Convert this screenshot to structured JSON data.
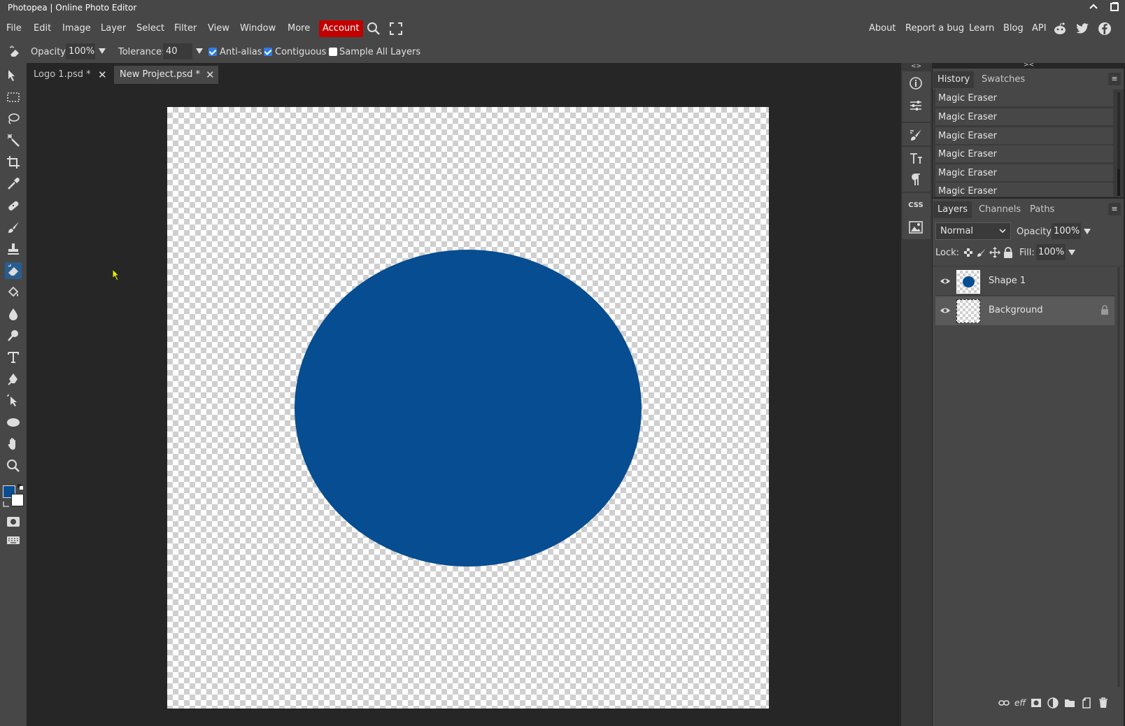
{
  "window": {
    "title": "Photopea | Online Photo Editor"
  },
  "menu": {
    "items": [
      "File",
      "Edit",
      "Image",
      "Layer",
      "Select",
      "Filter",
      "View",
      "Window",
      "More"
    ],
    "account": "Account",
    "right_links": [
      "About",
      "Report a bug",
      "Learn",
      "Blog",
      "API"
    ]
  },
  "options": {
    "opacity_label": "Opacity:",
    "opacity_value": "100%",
    "tolerance_label": "Tolerance:",
    "tolerance_value": "40",
    "anti_alias_label": "Anti-alias",
    "anti_alias_checked": true,
    "contiguous_label": "Contiguous",
    "contiguous_checked": true,
    "sample_all_label": "Sample All Layers",
    "sample_all_checked": false
  },
  "tabs": [
    {
      "label": "Logo 1.psd *",
      "active": false
    },
    {
      "label": "New Project.psd *",
      "active": true
    }
  ],
  "canvas": {
    "shape_color": "#074d91"
  },
  "colors": {
    "foreground": "#074d91",
    "background": "#ffffff",
    "accent": "#c30000"
  },
  "history": {
    "tabs": [
      "History",
      "Swatches"
    ],
    "items": [
      "Magic Eraser",
      "Magic Eraser",
      "Magic Eraser",
      "Magic Eraser",
      "Magic Eraser",
      "Magic Eraser"
    ]
  },
  "layers_panel": {
    "tabs": [
      "Layers",
      "Channels",
      "Paths"
    ],
    "blend_mode": "Normal",
    "opacity_label": "Opacity:",
    "opacity_value": "100%",
    "lock_label": "Lock:",
    "fill_label": "Fill:",
    "fill_value": "100%",
    "layers": [
      {
        "name": "Shape 1",
        "visible": true,
        "locked": false
      },
      {
        "name": "Background",
        "visible": true,
        "locked": true
      }
    ]
  },
  "side_icons": {
    "css_label": "CSS"
  },
  "bottom_icons": {
    "effects_label": "eff"
  }
}
